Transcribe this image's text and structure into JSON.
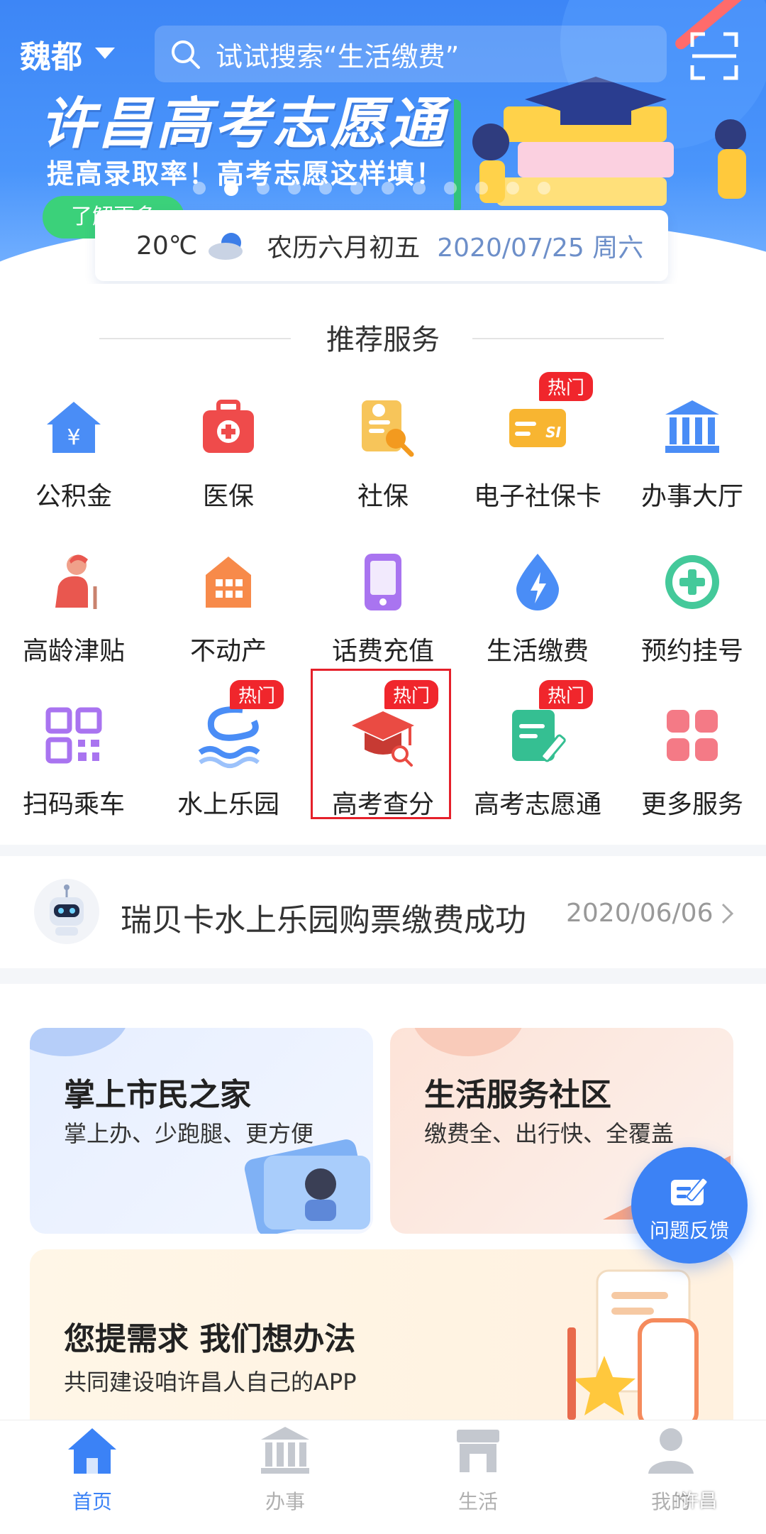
{
  "header": {
    "city": "魏都",
    "search_placeholder": "试试搜索“生活缴费”"
  },
  "banner": {
    "title": "许昌高考志愿通",
    "subtitle": "提高录取率！高考志愿这样填！",
    "button": "了解更多",
    "dots_count": 12,
    "active_dot": 1
  },
  "weather": {
    "temperature": "20℃",
    "icon": "cloudy-icon",
    "lunar": "农历六月初五",
    "date": "2020/07/25 周六"
  },
  "services": {
    "title": "推荐服务",
    "hot_label": "热门",
    "items": [
      {
        "label": "公积金",
        "icon": "fund-house-icon",
        "hot": false
      },
      {
        "label": "医保",
        "icon": "medical-kit-icon",
        "hot": false
      },
      {
        "label": "社保",
        "icon": "social-security-icon",
        "hot": false
      },
      {
        "label": "电子社保卡",
        "icon": "si-card-icon",
        "hot": true
      },
      {
        "label": "办事大厅",
        "icon": "hall-building-icon",
        "hot": false
      },
      {
        "label": "高龄津贴",
        "icon": "elderly-icon",
        "hot": false
      },
      {
        "label": "不动产",
        "icon": "building-icon",
        "hot": false
      },
      {
        "label": "话费充值",
        "icon": "phone-icon",
        "hot": false
      },
      {
        "label": "生活缴费",
        "icon": "utility-drop-icon",
        "hot": false
      },
      {
        "label": "预约挂号",
        "icon": "medical-plus-icon",
        "hot": false
      },
      {
        "label": "扫码乘车",
        "icon": "qr-code-icon",
        "hot": false
      },
      {
        "label": "水上乐园",
        "icon": "water-slide-icon",
        "hot": true
      },
      {
        "label": "高考查分",
        "icon": "grad-cap-search-icon",
        "hot": true
      },
      {
        "label": "高考志愿通",
        "icon": "note-pen-icon",
        "hot": true
      },
      {
        "label": "更多服务",
        "icon": "more-grid-icon",
        "hot": false
      }
    ]
  },
  "notice": {
    "text": "瑞贝卡水上乐园购票缴费成功",
    "date": "2020/06/06"
  },
  "cards": [
    {
      "title": "掌上市民之家",
      "subtitle": "掌上办、少跑腿、更方便"
    },
    {
      "title": "生活服务社区",
      "subtitle": "缴费全、出行快、全覆盖"
    },
    {
      "title": "您提需求 我们想办法",
      "subtitle": "共同建设咱许昌人自己的APP"
    }
  ],
  "feedback": {
    "label": "问题反馈"
  },
  "tabbar": [
    {
      "label": "首页",
      "icon": "home-icon",
      "active": true
    },
    {
      "label": "办事",
      "icon": "hall-icon",
      "active": false
    },
    {
      "label": "生活",
      "icon": "shop-icon",
      "active": false
    },
    {
      "label": "我的",
      "icon": "user-icon",
      "active": false
    }
  ],
  "watermark": "i许昌",
  "colors": {
    "primary": "#3b82f6",
    "hot": "#f0262c",
    "highlight": "#e5202a"
  }
}
